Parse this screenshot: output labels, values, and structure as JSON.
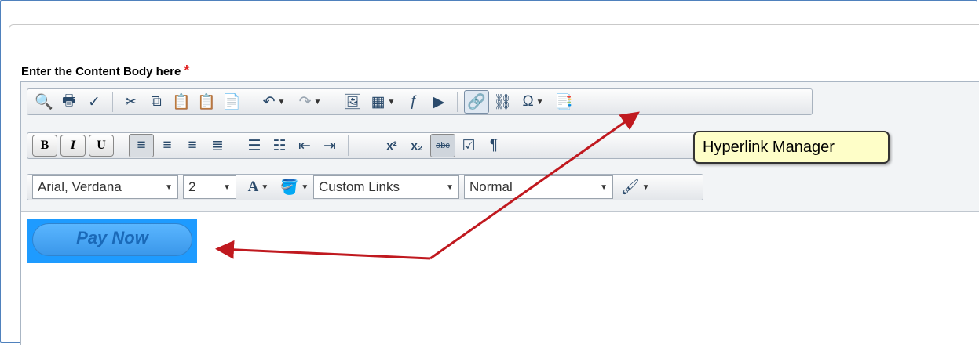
{
  "editor": {
    "label": "Enter the Content Body here",
    "required_mark": "*",
    "toolbar_row1": {
      "icons": [
        "find-replace-icon",
        "print-icon",
        "spellcheck-icon",
        "cut-icon",
        "copy-icon",
        "paste-icon",
        "paste-from-word-icon",
        "paste-plain-text-icon",
        "undo-icon",
        "redo-icon",
        "image-manager-icon",
        "insert-table-icon",
        "flash-manager-icon",
        "media-manager-icon",
        "hyperlink-manager-icon",
        "remove-link-icon",
        "special-characters-icon",
        "template-manager-icon"
      ]
    },
    "toolbar_row2": {
      "bold": "B",
      "italic": "I",
      "underline": "U",
      "superscript_label": "x²",
      "subscript_label": "x₂",
      "strike_label": "abc"
    },
    "toolbar_row3": {
      "font_name": "Arial, Verdana",
      "font_size": "2",
      "custom_links": "Custom Links",
      "paragraph_style": "Normal"
    },
    "content_button": "Pay Now",
    "tooltip": "Hyperlink Manager"
  },
  "colors": {
    "required": "#e02020",
    "arrow": "#c0191f",
    "tooltip_bg": "#fefec8",
    "paynow_bg": "#1e9bff"
  }
}
